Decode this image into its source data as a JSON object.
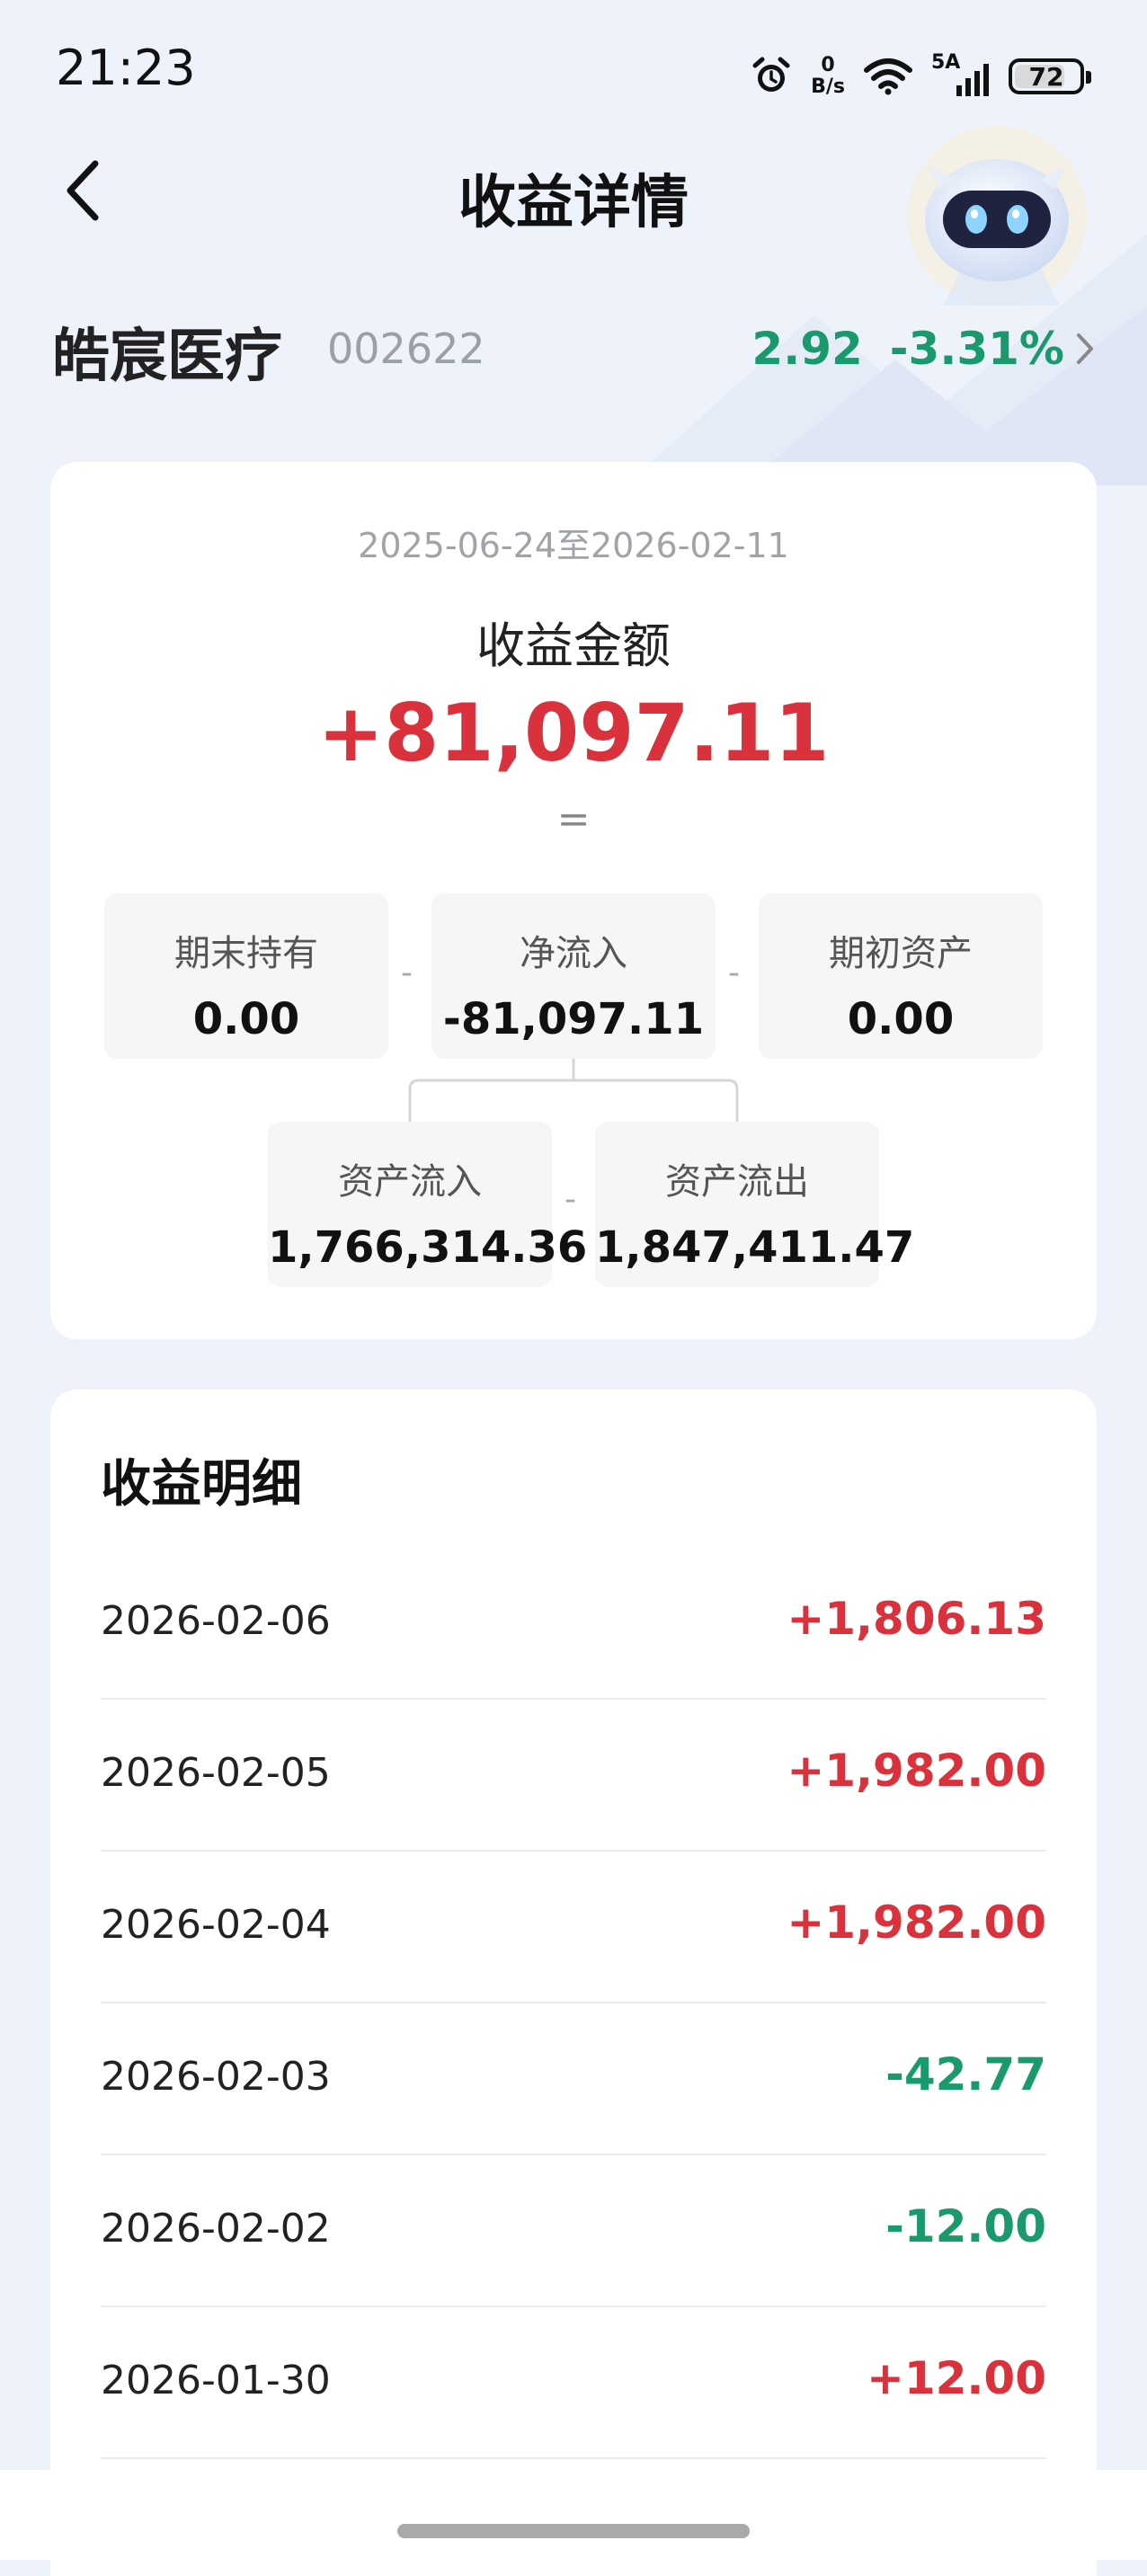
{
  "status_bar": {
    "time": "21:23",
    "net_speed_value": "0",
    "net_speed_unit": "B/s",
    "signal_label": "5A",
    "battery": "72"
  },
  "header": {
    "title": "收益详情",
    "back_icon": "chevron-left-icon",
    "assistant_icon": "robot-assistant-icon"
  },
  "stock": {
    "name": "皓宸医疗",
    "code": "002622",
    "price": "2.92",
    "change": "-3.31%"
  },
  "summary": {
    "date_range": "2025-06-24至2026-02-11",
    "label": "收益金额",
    "amount": "+81,097.11",
    "equals": "=",
    "end_holding": {
      "label": "期末持有",
      "value": "0.00"
    },
    "net_inflow": {
      "label": "净流入",
      "value": "-81,097.11"
    },
    "initial_assets": {
      "label": "期初资产",
      "value": "0.00"
    },
    "asset_inflow": {
      "label": "资产流入",
      "value": "1,766,314.36"
    },
    "asset_outflow": {
      "label": "资产流出",
      "value": "1,847,411.47"
    },
    "operator": "-"
  },
  "detail": {
    "title": "收益明细",
    "rows": [
      {
        "date": "2026-02-06",
        "value": "+1,806.13",
        "sign": "pos"
      },
      {
        "date": "2026-02-05",
        "value": "+1,982.00",
        "sign": "pos"
      },
      {
        "date": "2026-02-04",
        "value": "+1,982.00",
        "sign": "pos"
      },
      {
        "date": "2026-02-03",
        "value": "-42.77",
        "sign": "neg"
      },
      {
        "date": "2026-02-02",
        "value": "-12.00",
        "sign": "neg"
      },
      {
        "date": "2026-01-30",
        "value": "+12.00",
        "sign": "pos"
      }
    ]
  },
  "colors": {
    "positive": "#d9323c",
    "negative": "#1a9a6c",
    "background": "#eef2fa"
  }
}
